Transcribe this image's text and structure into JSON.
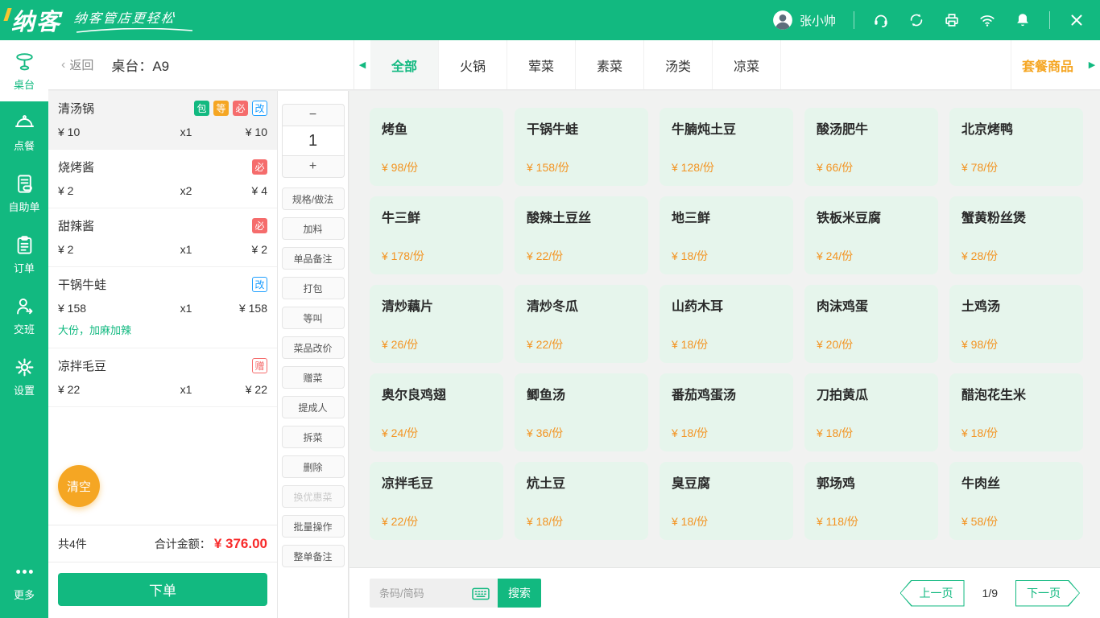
{
  "topbar": {
    "brand": "纳客",
    "slogan": "纳客管店更轻松",
    "user_name": "张小帅"
  },
  "sidebar": {
    "items": [
      {
        "label": "桌台",
        "active": true
      },
      {
        "label": "点餐"
      },
      {
        "label": "自助单"
      },
      {
        "label": "订单"
      },
      {
        "label": "交班"
      },
      {
        "label": "设置"
      }
    ],
    "more_label": "更多"
  },
  "header": {
    "back_label": "返回",
    "back_chevron": "‹",
    "table_label": "桌台：",
    "table_value": "A9"
  },
  "tabs": {
    "left_arrow": "◀",
    "right_arrow": "▶",
    "items": [
      {
        "label": "全部",
        "active": true
      },
      {
        "label": "火锅"
      },
      {
        "label": "荤菜"
      },
      {
        "label": "素菜"
      },
      {
        "label": "汤类"
      },
      {
        "label": "凉菜"
      }
    ],
    "combo_label": "套餐商品"
  },
  "order": {
    "items": [
      {
        "name": "清汤锅",
        "badges": [
          "包",
          "等",
          "必",
          "改"
        ],
        "price": "¥ 10",
        "qty": "x1",
        "total": "¥ 10",
        "selected": true
      },
      {
        "name": "烧烤酱",
        "badges": [
          "必"
        ],
        "price": "¥ 2",
        "qty": "x2",
        "total": "¥ 4"
      },
      {
        "name": "甜辣酱",
        "badges": [
          "必"
        ],
        "price": "¥ 2",
        "qty": "x1",
        "total": "¥ 2"
      },
      {
        "name": "干锅牛蛙",
        "badges": [
          "改"
        ],
        "price": "¥ 158",
        "qty": "x1",
        "total": "¥ 158",
        "note": "大份，加麻加辣"
      },
      {
        "name": "凉拌毛豆",
        "badges": [
          "赠"
        ],
        "price": "¥ 22",
        "qty": "x1",
        "total": "¥ 22"
      }
    ],
    "clear_label": "清空",
    "count_label": "共4件",
    "total_label": "合计金额：",
    "total_value": "¥ 376.00",
    "submit_label": "下单"
  },
  "actions": {
    "stepper": {
      "minus": "−",
      "value": "1",
      "plus": "+"
    },
    "buttons": [
      {
        "label": "规格/做法"
      },
      {
        "label": "加料"
      },
      {
        "label": "单品备注"
      },
      {
        "label": "打包"
      },
      {
        "label": "等叫"
      },
      {
        "label": "菜品改价"
      },
      {
        "label": "赠菜"
      },
      {
        "label": "提成人"
      },
      {
        "label": "拆菜"
      },
      {
        "label": "删除"
      },
      {
        "label": "换优惠菜",
        "disabled": true
      },
      {
        "label": "批量操作"
      },
      {
        "label": "整单备注"
      }
    ]
  },
  "menu": {
    "items": [
      {
        "name": "烤鱼",
        "price": "¥ 98/份"
      },
      {
        "name": "干锅牛蛙",
        "price": "¥ 158/份"
      },
      {
        "name": "牛腩炖土豆",
        "price": "¥ 128/份"
      },
      {
        "name": "酸汤肥牛",
        "price": "¥ 66/份"
      },
      {
        "name": "北京烤鸭",
        "price": "¥ 78/份"
      },
      {
        "name": "牛三鲜",
        "price": "¥ 178/份"
      },
      {
        "name": "酸辣土豆丝",
        "price": "¥ 22/份"
      },
      {
        "name": "地三鲜",
        "price": "¥ 18/份"
      },
      {
        "name": "铁板米豆腐",
        "price": "¥ 24/份"
      },
      {
        "name": "蟹黄粉丝煲",
        "price": "¥ 28/份"
      },
      {
        "name": "清炒藕片",
        "price": "¥ 26/份"
      },
      {
        "name": "清炒冬瓜",
        "price": "¥ 22/份"
      },
      {
        "name": "山药木耳",
        "price": "¥ 18/份"
      },
      {
        "name": "肉沫鸡蛋",
        "price": "¥ 20/份"
      },
      {
        "name": "土鸡汤",
        "price": "¥ 98/份"
      },
      {
        "name": "奥尔良鸡翅",
        "price": "¥ 24/份"
      },
      {
        "name": "鲫鱼汤",
        "price": "¥ 36/份"
      },
      {
        "name": "番茄鸡蛋汤",
        "price": "¥ 18/份"
      },
      {
        "name": "刀拍黄瓜",
        "price": "¥ 18/份"
      },
      {
        "name": "醋泡花生米",
        "price": "¥ 18/份"
      },
      {
        "name": "凉拌毛豆",
        "price": "¥ 22/份"
      },
      {
        "name": "炕土豆",
        "price": "¥ 18/份"
      },
      {
        "name": "臭豆腐",
        "price": "¥ 18/份"
      },
      {
        "name": "郭场鸡",
        "price": "¥ 118/份"
      },
      {
        "name": "牛肉丝",
        "price": "¥ 58/份"
      }
    ]
  },
  "footer": {
    "search_placeholder": "条码/简码",
    "search_label": "搜索",
    "prev_label": "上一页",
    "page_indicator": "1/9",
    "next_label": "下一页"
  },
  "colors": {
    "theme_green": "#12B980",
    "orange": "#F5A623",
    "price_orange": "#F39422",
    "badge_red": "#F56C6C",
    "total_red": "#F82A2A",
    "badge_blue": "#1E9FFF",
    "card_mint": "#E6F5EC"
  }
}
